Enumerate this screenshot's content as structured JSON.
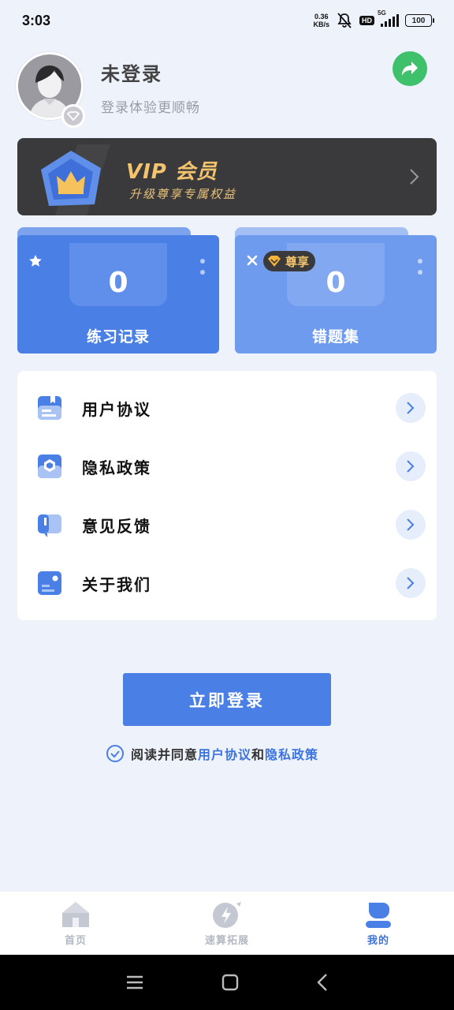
{
  "status_bar": {
    "time": "3:03",
    "net_speed_value": "0.36",
    "net_speed_unit": "KB/s",
    "hd": "HD",
    "network": "5G",
    "battery": "100"
  },
  "profile": {
    "name": "未登录",
    "subtitle": "登录体验更顺畅"
  },
  "vip": {
    "title_vip": "VIP",
    "title_member": "会员",
    "subtitle": "升级尊享专属权益"
  },
  "stats": {
    "practice": {
      "count": "0",
      "label": "练习记录"
    },
    "wrong": {
      "count": "0",
      "label": "错题集",
      "badge": "尊享"
    }
  },
  "menu": {
    "items": [
      {
        "label": "用户协议",
        "icon": "document-icon"
      },
      {
        "label": "隐私政策",
        "icon": "privacy-icon"
      },
      {
        "label": "意见反馈",
        "icon": "feedback-icon"
      },
      {
        "label": "关于我们",
        "icon": "about-icon"
      }
    ]
  },
  "login": {
    "button_label": "立即登录",
    "agree_prefix": "阅读并同意",
    "agree_link_1": "用户协议",
    "agree_and": "和",
    "agree_link_2": "隐私政策"
  },
  "nav": {
    "items": [
      {
        "label": "首页",
        "icon": "home-icon"
      },
      {
        "label": "速算拓展",
        "icon": "speed-calc-icon"
      },
      {
        "label": "我的",
        "icon": "profile-icon"
      }
    ],
    "active_index": 2
  },
  "colors": {
    "primary": "#4a7fe6",
    "share_green": "#3fc06a",
    "vip_gold": "#f3c46d",
    "background": "#eef2fb"
  }
}
